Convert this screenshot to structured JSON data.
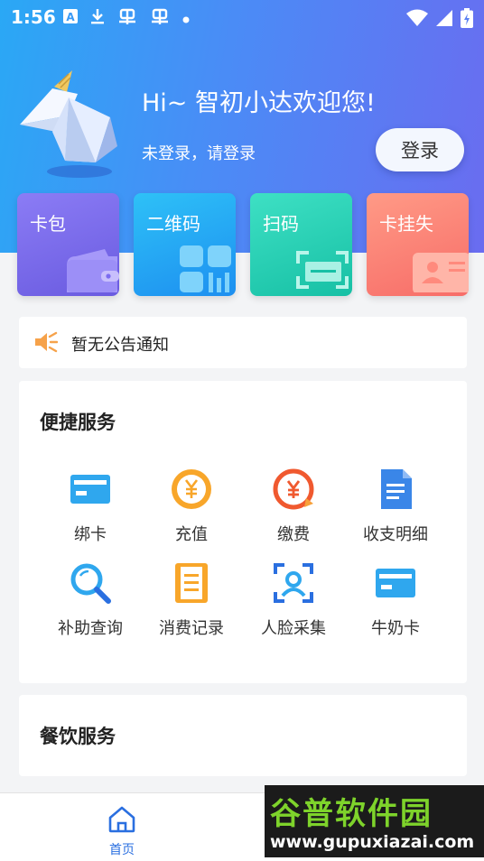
{
  "status_bar": {
    "time": "1:56",
    "left_icons": [
      "a-badge-icon",
      "download-icon",
      "bug-icon",
      "bug-icon",
      "dot-icon"
    ],
    "right_icons": [
      "wifi-icon",
      "signal-icon",
      "battery-icon"
    ]
  },
  "header": {
    "greeting": "Hi~ 智初小达欢迎您!",
    "login_hint": "未登录，请登录",
    "login_button": "登录"
  },
  "quick_actions": [
    {
      "label": "卡包",
      "icon": "wallet-icon",
      "color": "#7b6cf0"
    },
    {
      "label": "二维码",
      "icon": "qrcode-icon",
      "color": "#27adf5"
    },
    {
      "label": "扫码",
      "icon": "scan-icon",
      "color": "#2fd3b6"
    },
    {
      "label": "卡挂失",
      "icon": "id-card-icon",
      "color": "#fb8579"
    }
  ],
  "notice": {
    "text": "暂无公告通知",
    "icon": "speaker-icon"
  },
  "convenient_services": {
    "title": "便捷服务",
    "items": [
      {
        "label": "绑卡",
        "icon": "card-icon"
      },
      {
        "label": "充值",
        "icon": "yuan-coin-icon"
      },
      {
        "label": "缴费",
        "icon": "yuan-refresh-icon"
      },
      {
        "label": "收支明细",
        "icon": "document-icon"
      },
      {
        "label": "补助查询",
        "icon": "search-icon"
      },
      {
        "label": "消费记录",
        "icon": "receipt-icon"
      },
      {
        "label": "人脸采集",
        "icon": "face-scan-icon"
      },
      {
        "label": "牛奶卡",
        "icon": "card-icon"
      }
    ]
  },
  "dining_services": {
    "title": "餐饮服务"
  },
  "tabbar": {
    "home_label": "首页",
    "home_icon": "home-icon"
  },
  "watermark": {
    "title": "谷普软件园",
    "url": "www.gupuxiazai.com"
  }
}
